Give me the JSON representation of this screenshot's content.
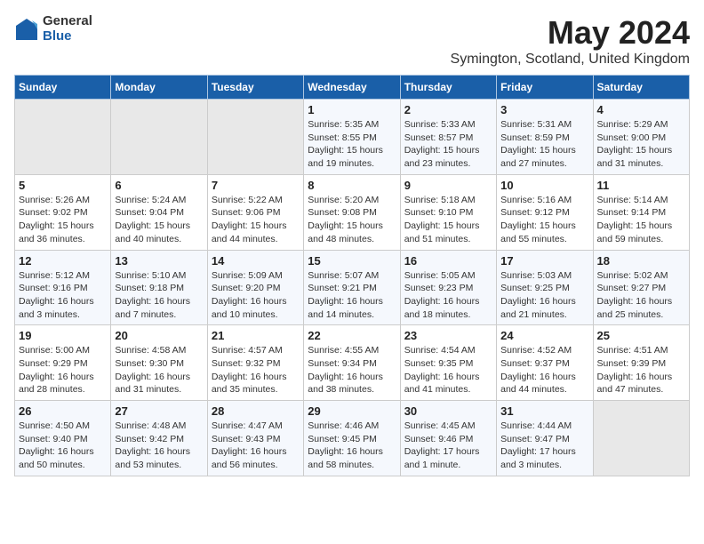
{
  "logo": {
    "general": "General",
    "blue": "Blue"
  },
  "title": "May 2024",
  "subtitle": "Symington, Scotland, United Kingdom",
  "days_of_week": [
    "Sunday",
    "Monday",
    "Tuesday",
    "Wednesday",
    "Thursday",
    "Friday",
    "Saturday"
  ],
  "weeks": [
    [
      {
        "day": "",
        "info": ""
      },
      {
        "day": "",
        "info": ""
      },
      {
        "day": "",
        "info": ""
      },
      {
        "day": "1",
        "info": "Sunrise: 5:35 AM\nSunset: 8:55 PM\nDaylight: 15 hours\nand 19 minutes."
      },
      {
        "day": "2",
        "info": "Sunrise: 5:33 AM\nSunset: 8:57 PM\nDaylight: 15 hours\nand 23 minutes."
      },
      {
        "day": "3",
        "info": "Sunrise: 5:31 AM\nSunset: 8:59 PM\nDaylight: 15 hours\nand 27 minutes."
      },
      {
        "day": "4",
        "info": "Sunrise: 5:29 AM\nSunset: 9:00 PM\nDaylight: 15 hours\nand 31 minutes."
      }
    ],
    [
      {
        "day": "5",
        "info": "Sunrise: 5:26 AM\nSunset: 9:02 PM\nDaylight: 15 hours\nand 36 minutes."
      },
      {
        "day": "6",
        "info": "Sunrise: 5:24 AM\nSunset: 9:04 PM\nDaylight: 15 hours\nand 40 minutes."
      },
      {
        "day": "7",
        "info": "Sunrise: 5:22 AM\nSunset: 9:06 PM\nDaylight: 15 hours\nand 44 minutes."
      },
      {
        "day": "8",
        "info": "Sunrise: 5:20 AM\nSunset: 9:08 PM\nDaylight: 15 hours\nand 48 minutes."
      },
      {
        "day": "9",
        "info": "Sunrise: 5:18 AM\nSunset: 9:10 PM\nDaylight: 15 hours\nand 51 minutes."
      },
      {
        "day": "10",
        "info": "Sunrise: 5:16 AM\nSunset: 9:12 PM\nDaylight: 15 hours\nand 55 minutes."
      },
      {
        "day": "11",
        "info": "Sunrise: 5:14 AM\nSunset: 9:14 PM\nDaylight: 15 hours\nand 59 minutes."
      }
    ],
    [
      {
        "day": "12",
        "info": "Sunrise: 5:12 AM\nSunset: 9:16 PM\nDaylight: 16 hours\nand 3 minutes."
      },
      {
        "day": "13",
        "info": "Sunrise: 5:10 AM\nSunset: 9:18 PM\nDaylight: 16 hours\nand 7 minutes."
      },
      {
        "day": "14",
        "info": "Sunrise: 5:09 AM\nSunset: 9:20 PM\nDaylight: 16 hours\nand 10 minutes."
      },
      {
        "day": "15",
        "info": "Sunrise: 5:07 AM\nSunset: 9:21 PM\nDaylight: 16 hours\nand 14 minutes."
      },
      {
        "day": "16",
        "info": "Sunrise: 5:05 AM\nSunset: 9:23 PM\nDaylight: 16 hours\nand 18 minutes."
      },
      {
        "day": "17",
        "info": "Sunrise: 5:03 AM\nSunset: 9:25 PM\nDaylight: 16 hours\nand 21 minutes."
      },
      {
        "day": "18",
        "info": "Sunrise: 5:02 AM\nSunset: 9:27 PM\nDaylight: 16 hours\nand 25 minutes."
      }
    ],
    [
      {
        "day": "19",
        "info": "Sunrise: 5:00 AM\nSunset: 9:29 PM\nDaylight: 16 hours\nand 28 minutes."
      },
      {
        "day": "20",
        "info": "Sunrise: 4:58 AM\nSunset: 9:30 PM\nDaylight: 16 hours\nand 31 minutes."
      },
      {
        "day": "21",
        "info": "Sunrise: 4:57 AM\nSunset: 9:32 PM\nDaylight: 16 hours\nand 35 minutes."
      },
      {
        "day": "22",
        "info": "Sunrise: 4:55 AM\nSunset: 9:34 PM\nDaylight: 16 hours\nand 38 minutes."
      },
      {
        "day": "23",
        "info": "Sunrise: 4:54 AM\nSunset: 9:35 PM\nDaylight: 16 hours\nand 41 minutes."
      },
      {
        "day": "24",
        "info": "Sunrise: 4:52 AM\nSunset: 9:37 PM\nDaylight: 16 hours\nand 44 minutes."
      },
      {
        "day": "25",
        "info": "Sunrise: 4:51 AM\nSunset: 9:39 PM\nDaylight: 16 hours\nand 47 minutes."
      }
    ],
    [
      {
        "day": "26",
        "info": "Sunrise: 4:50 AM\nSunset: 9:40 PM\nDaylight: 16 hours\nand 50 minutes."
      },
      {
        "day": "27",
        "info": "Sunrise: 4:48 AM\nSunset: 9:42 PM\nDaylight: 16 hours\nand 53 minutes."
      },
      {
        "day": "28",
        "info": "Sunrise: 4:47 AM\nSunset: 9:43 PM\nDaylight: 16 hours\nand 56 minutes."
      },
      {
        "day": "29",
        "info": "Sunrise: 4:46 AM\nSunset: 9:45 PM\nDaylight: 16 hours\nand 58 minutes."
      },
      {
        "day": "30",
        "info": "Sunrise: 4:45 AM\nSunset: 9:46 PM\nDaylight: 17 hours\nand 1 minute."
      },
      {
        "day": "31",
        "info": "Sunrise: 4:44 AM\nSunset: 9:47 PM\nDaylight: 17 hours\nand 3 minutes."
      },
      {
        "day": "",
        "info": ""
      }
    ]
  ]
}
